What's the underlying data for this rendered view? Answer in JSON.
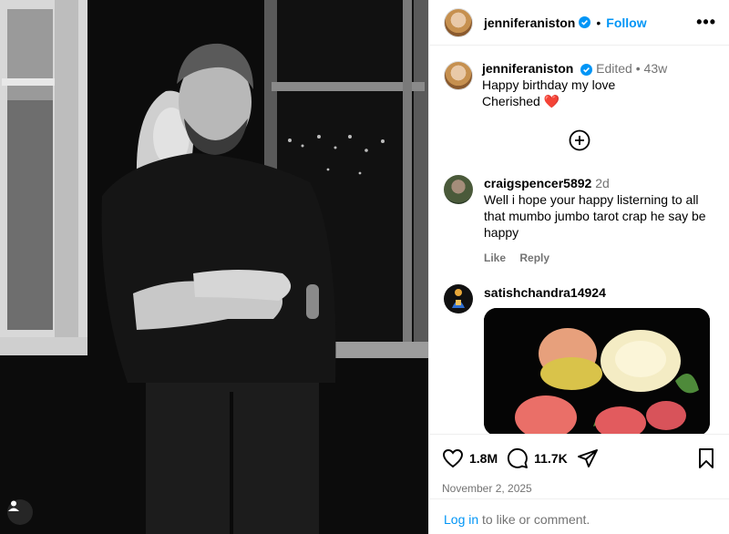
{
  "post": {
    "username": "jenniferaniston",
    "follow_label": "Follow",
    "more_label": "•••",
    "separator": "•"
  },
  "caption": {
    "username": "jenniferaniston",
    "edited": "Edited",
    "separator": "•",
    "age": "43w",
    "line1": "Happy birthday my love",
    "line2": "Cherished ❤️"
  },
  "comments": [
    {
      "username": "craigspencer5892",
      "age": "2d",
      "text": "Well i hope your happy listerning to all that mumbo jumbo tarot crap he say be happy",
      "like_label": "Like",
      "reply_label": "Reply"
    },
    {
      "username": "satishchandra14924"
    }
  ],
  "footer": {
    "likes": "1.8M",
    "comments": "11.7K",
    "date": "November 2, 2025",
    "login_link": "Log in",
    "login_rest": " to like or comment."
  },
  "colors": {
    "link": "#0095f6",
    "verified": "#0095f6",
    "heart": "#e0245e",
    "muted": "#737373"
  },
  "icons": {
    "more": "ellipsis-icon",
    "verified": "verified-badge-icon",
    "load": "plus-circle-icon",
    "like": "heart-icon",
    "comment": "comment-icon",
    "share": "send-icon",
    "save": "bookmark-icon",
    "tag": "user-tag-icon"
  }
}
